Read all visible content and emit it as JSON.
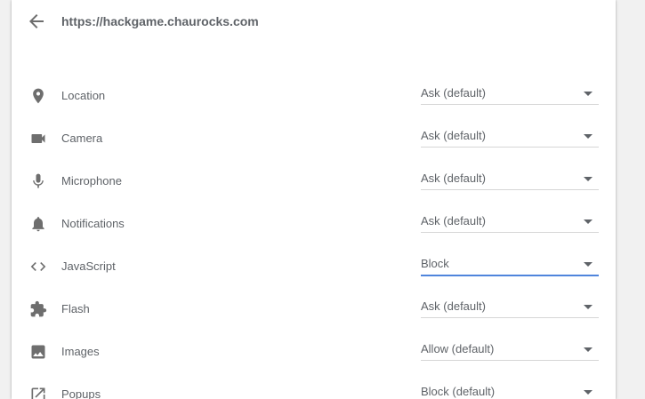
{
  "header": {
    "site_url": "https://hackgame.chaurocks.com"
  },
  "colors": {
    "icon": "#6e6e6e",
    "text": "#5f6368",
    "accent": "#4f85dc"
  },
  "permissions": [
    {
      "icon": "location-pin-icon",
      "label": "Location",
      "value": "Ask (default)"
    },
    {
      "icon": "camera-icon",
      "label": "Camera",
      "value": "Ask (default)"
    },
    {
      "icon": "microphone-icon",
      "label": "Microphone",
      "value": "Ask (default)"
    },
    {
      "icon": "bell-icon",
      "label": "Notifications",
      "value": "Ask (default)"
    },
    {
      "icon": "code-brackets-icon",
      "label": "JavaScript",
      "value": "Block"
    },
    {
      "icon": "puzzle-piece-icon",
      "label": "Flash",
      "value": "Ask (default)"
    },
    {
      "icon": "image-icon",
      "label": "Images",
      "value": "Allow (default)"
    },
    {
      "icon": "open-in-new-icon",
      "label": "Popups",
      "value": "Block (default)"
    }
  ]
}
